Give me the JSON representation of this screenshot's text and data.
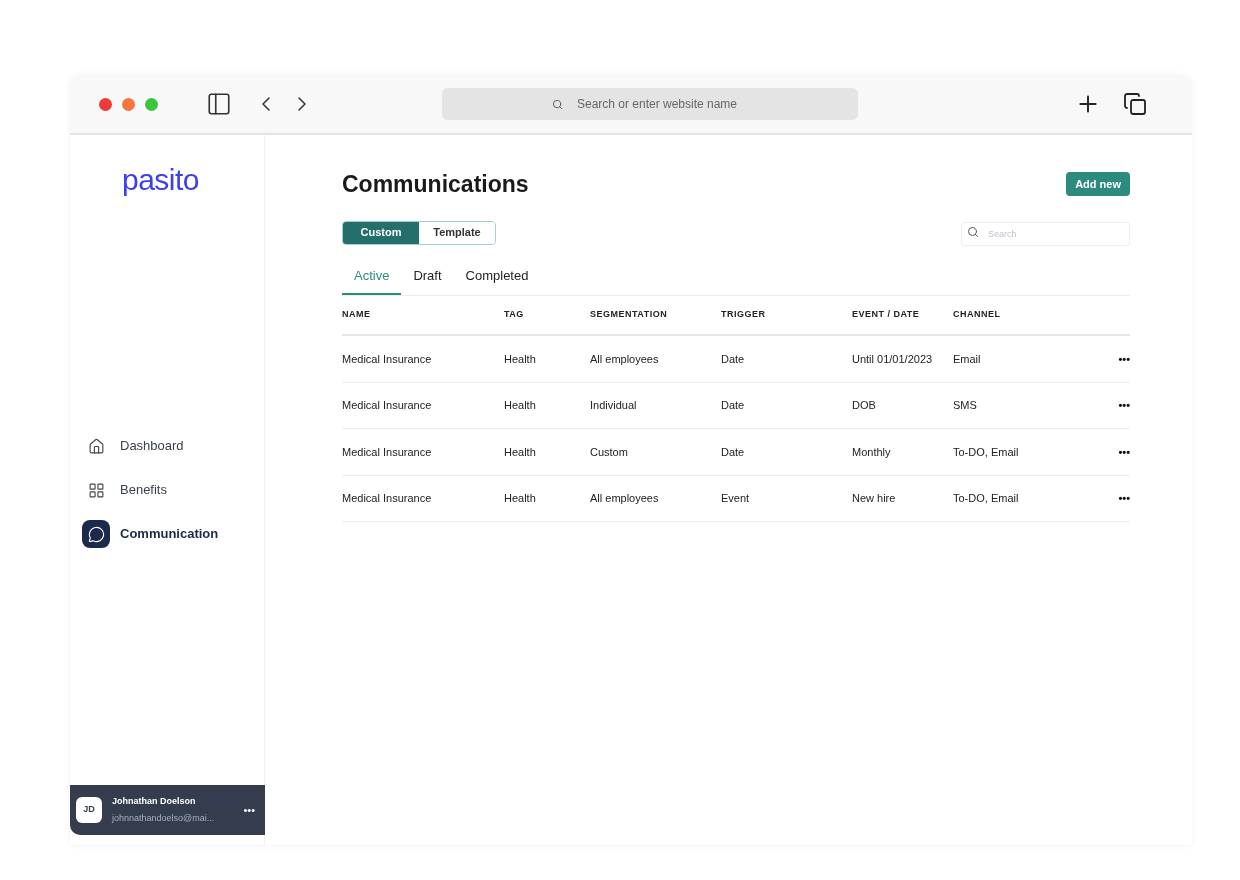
{
  "browser": {
    "address_placeholder": "Search or enter website name"
  },
  "sidebar": {
    "logo": "pasito",
    "items": [
      {
        "label": "Dashboard",
        "kind": "home",
        "selected": false
      },
      {
        "label": "Benefits",
        "kind": "grid",
        "selected": false
      },
      {
        "label": "Communication",
        "kind": "message",
        "selected": true
      }
    ],
    "user": {
      "initials": "JD",
      "name": "Johnathan Doelson",
      "email": "johnnathandoelso@mai...",
      "menu": "•••"
    }
  },
  "page": {
    "title": "Communications",
    "add_button": "Add new",
    "segments": [
      {
        "label": "Custom",
        "selected": true
      },
      {
        "label": "Template",
        "selected": false
      }
    ],
    "search": {
      "placeholder": "Search"
    },
    "tabs": [
      {
        "label": "Active",
        "selected": true
      },
      {
        "label": "Draft",
        "selected": false
      },
      {
        "label": "Completed",
        "selected": false
      }
    ]
  },
  "table": {
    "columns": [
      "NAME",
      "TAG",
      "SEGMENTATION",
      "TRIGGER",
      "EVENT / DATE",
      "CHANNEL"
    ],
    "rows": [
      {
        "cells": [
          "Medical Insurance",
          "Health",
          "All employees",
          "Date",
          "Until 01/01/2023",
          "Email"
        ],
        "menu": "•••"
      },
      {
        "cells": [
          "Medical Insurance",
          "Health",
          "Individual",
          "Date",
          "DOB",
          "SMS"
        ],
        "menu": "•••"
      },
      {
        "cells": [
          "Medical Insurance",
          "Health",
          "Custom",
          "Date",
          "Monthly",
          "To-DO, Email"
        ],
        "menu": "•••"
      },
      {
        "cells": [
          "Medical Insurance",
          "Health",
          "All employees",
          "Event",
          "New hire",
          "To-DO, Email"
        ],
        "menu": "•••"
      }
    ]
  }
}
